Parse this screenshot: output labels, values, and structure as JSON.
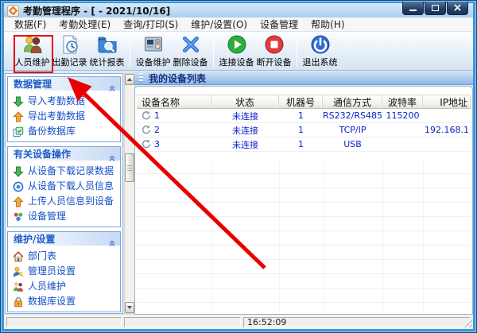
{
  "window": {
    "title": "考勤管理程序 - [ - 2021/10/16]"
  },
  "menu": {
    "items": [
      "数据(F)",
      "考勤处理(E)",
      "查询/打印(S)",
      "维护/设置(O)",
      "设备管理",
      "帮助(H)"
    ]
  },
  "toolbar": {
    "buttons": [
      {
        "label": "人员维护",
        "icon": "people-icon"
      },
      {
        "label": "出勤记录",
        "icon": "attendance-record-icon"
      },
      {
        "label": "统计报表",
        "icon": "report-icon"
      },
      {
        "label": "设备维护",
        "icon": "device-icon"
      },
      {
        "label": "删除设备",
        "icon": "delete-icon"
      },
      {
        "label": "连接设备",
        "icon": "connect-icon"
      },
      {
        "label": "断开设备",
        "icon": "disconnect-icon"
      },
      {
        "label": "退出系统",
        "icon": "power-icon"
      }
    ]
  },
  "sidebar": {
    "sections": [
      {
        "title": "数据管理",
        "items": [
          {
            "label": "导入考勤数据",
            "icon": "import-icon"
          },
          {
            "label": "导出考勤数据",
            "icon": "export-icon"
          },
          {
            "label": "备份数据库",
            "icon": "backup-icon"
          }
        ]
      },
      {
        "title": "有关设备操作",
        "items": [
          {
            "label": "从设备下载记录数据",
            "icon": "download-records-icon"
          },
          {
            "label": "从设备下载人员信息",
            "icon": "download-people-icon"
          },
          {
            "label": "上传人员信息到设备",
            "icon": "upload-people-icon"
          },
          {
            "label": "设备管理",
            "icon": "device-manage-icon"
          }
        ]
      },
      {
        "title": "维护/设置",
        "items": [
          {
            "label": "部门表",
            "icon": "department-icon"
          },
          {
            "label": "管理员设置",
            "icon": "admin-icon"
          },
          {
            "label": "人员维护",
            "icon": "staff-icon"
          },
          {
            "label": "数据库设置",
            "icon": "database-icon"
          }
        ]
      }
    ]
  },
  "main": {
    "panel_title": "我的设备列表",
    "table": {
      "columns": [
        "设备名称",
        "状态",
        "机器号",
        "通信方式",
        "波特率",
        "IP地址"
      ],
      "rows": [
        {
          "name": "1",
          "status": "未连接",
          "machine": "1",
          "comm": "RS232/RS485",
          "baud": "115200",
          "ip": ""
        },
        {
          "name": "2",
          "status": "未连接",
          "machine": "1",
          "comm": "TCP/IP",
          "baud": "",
          "ip": "192.168.1"
        },
        {
          "name": "3",
          "status": "未连接",
          "machine": "1",
          "comm": "USB",
          "baud": "",
          "ip": ""
        }
      ]
    }
  },
  "statusbar": {
    "time": "16:52:09"
  },
  "colors": {
    "annotation_red": "#e80000",
    "section_title": "#215dc6",
    "sidebar_link": "#1550c8",
    "table_text": "#0a23cc",
    "panel_header_text": "#16307e"
  }
}
